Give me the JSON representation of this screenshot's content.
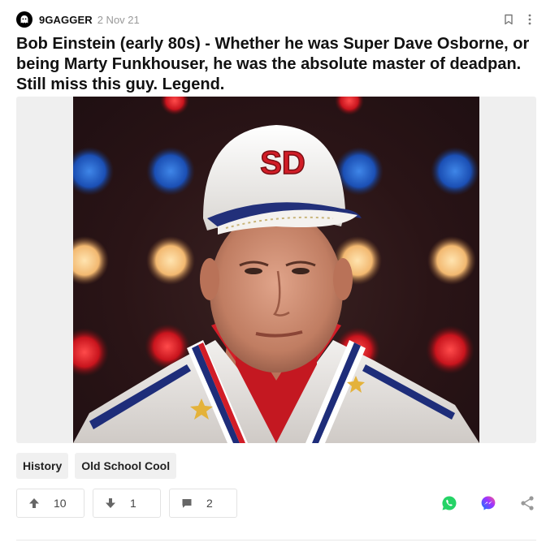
{
  "post": {
    "source": "9GAGGER",
    "date": "2 Nov 21",
    "title": "Bob Einstein (early 80s) - Whether he was Super Dave Osborne, or being Marty Funkhouser, he was the absolute master of deadpan. Still miss this guy. Legend.",
    "image": {
      "cap_logo_text": "SD"
    },
    "tags": [
      "History",
      "Old School Cool"
    ],
    "actions": {
      "upvotes": "10",
      "downvotes": "1",
      "comments": "2"
    }
  },
  "icons": {
    "source_avatar": "ghost-logo-icon",
    "save": "bookmark-icon",
    "more": "more-vertical-icon",
    "upvote": "arrow-up-icon",
    "downvote": "arrow-down-icon",
    "comment": "comment-bubble-icon",
    "whatsapp": "whatsapp-icon",
    "messenger": "messenger-icon",
    "share": "share-icon"
  },
  "colors": {
    "whatsapp": "#25D366",
    "messenger_start": "#0A7CFF",
    "messenger_end": "#FF5C87",
    "muted_icon": "#999999",
    "text": "#111111"
  }
}
